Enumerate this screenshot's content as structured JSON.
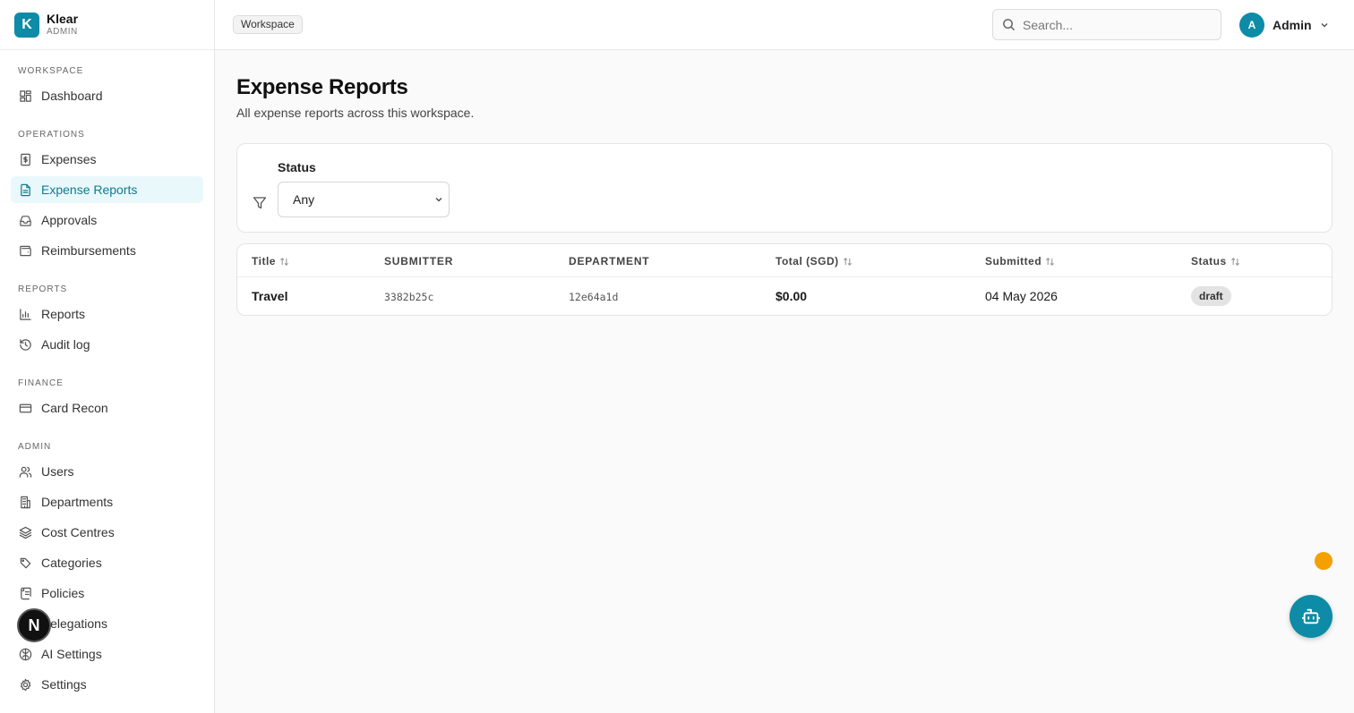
{
  "brand": {
    "logo_letter": "K",
    "name": "Klear",
    "sub": "ADMIN",
    "color": "#0e8ba6"
  },
  "sidebar": {
    "sections": [
      {
        "label": "WORKSPACE",
        "items": [
          {
            "label": "Dashboard",
            "icon": "dashboard-icon"
          }
        ]
      },
      {
        "label": "OPERATIONS",
        "items": [
          {
            "label": "Expenses",
            "icon": "receipt-dollar-icon"
          },
          {
            "label": "Expense Reports",
            "icon": "file-text-icon",
            "active": true
          },
          {
            "label": "Approvals",
            "icon": "inbox-icon"
          },
          {
            "label": "Reimbursements",
            "icon": "wallet-icon"
          }
        ]
      },
      {
        "label": "REPORTS",
        "items": [
          {
            "label": "Reports",
            "icon": "bar-chart-icon"
          },
          {
            "label": "Audit log",
            "icon": "history-icon"
          }
        ]
      },
      {
        "label": "FINANCE",
        "items": [
          {
            "label": "Card Recon",
            "icon": "credit-card-icon"
          }
        ]
      },
      {
        "label": "ADMIN",
        "items": [
          {
            "label": "Users",
            "icon": "users-icon"
          },
          {
            "label": "Departments",
            "icon": "building-icon"
          },
          {
            "label": "Cost Centres",
            "icon": "layers-icon"
          },
          {
            "label": "Categories",
            "icon": "tags-icon"
          },
          {
            "label": "Policies",
            "icon": "scroll-icon"
          },
          {
            "label": "Delegations",
            "icon": "user-arrow-icon"
          },
          {
            "label": "AI Settings",
            "icon": "brain-icon"
          },
          {
            "label": "Settings",
            "icon": "gear-icon"
          }
        ]
      }
    ]
  },
  "header": {
    "breadcrumb": "Workspace",
    "search_placeholder": "Search...",
    "user": {
      "initial": "A",
      "name": "Admin"
    }
  },
  "main": {
    "title": "Expense Reports",
    "subtitle": "All expense reports across this workspace.",
    "filter": {
      "label": "Status",
      "value": "Any"
    },
    "table": {
      "columns": [
        "Title",
        "SUBMITTER",
        "DEPARTMENT",
        "Total (SGD)",
        "Submitted",
        "Status"
      ],
      "rows": [
        {
          "title": "Travel",
          "submitter": "3382b25c",
          "department": "12e64a1d",
          "total": "$0.00",
          "submitted": "04 May 2026",
          "status": "draft"
        }
      ]
    }
  },
  "widgets": {
    "dev_badge": "N",
    "notification_color": "#f5a000",
    "assistant_icon": "robot-icon"
  }
}
